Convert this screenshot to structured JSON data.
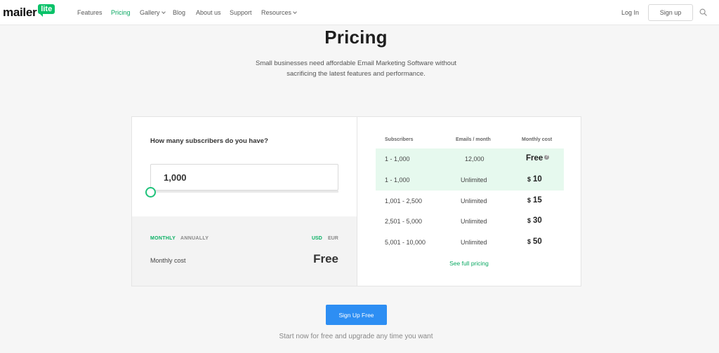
{
  "header": {
    "logo_text": "mailer",
    "logo_badge": "lite",
    "nav": [
      {
        "label": "Features"
      },
      {
        "label": "Pricing"
      },
      {
        "label": "Gallery"
      },
      {
        "label": "Blog"
      },
      {
        "label": "About us"
      },
      {
        "label": "Support"
      },
      {
        "label": "Resources"
      }
    ],
    "login_label": "Log In",
    "signup_label": "Sign up",
    "search_icon": "search-icon"
  },
  "hero": {
    "title": "Pricing",
    "subtitle": "Small businesses need affordable Email Marketing Software without sacrificing the latest features and performance."
  },
  "calculator": {
    "question": "How many subscribers do you have?",
    "subscribers_value": "1,000",
    "billing": {
      "monthly": "MONTHLY",
      "annually": "ANNUALLY"
    },
    "currency": {
      "usd": "USD",
      "eur": "EUR"
    },
    "cost_label": "Monthly cost",
    "cost_value": "Free"
  },
  "pricing_table": {
    "headers": {
      "subscribers": "Subscribers",
      "emails": "Emails / month",
      "cost": "Monthly cost"
    },
    "rows": [
      {
        "subscribers": "1 - 1,000",
        "emails": "12,000",
        "currency": "",
        "price": "Free",
        "help": "?"
      },
      {
        "subscribers": "1 - 1,000",
        "emails": "Unlimited",
        "currency": "$",
        "price": "10"
      },
      {
        "subscribers": "1,001 - 2,500",
        "emails": "Unlimited",
        "currency": "$",
        "price": "15"
      },
      {
        "subscribers": "2,501 - 5,000",
        "emails": "Unlimited",
        "currency": "$",
        "price": "30"
      },
      {
        "subscribers": "5,001 - 10,000",
        "emails": "Unlimited",
        "currency": "$",
        "price": "50"
      }
    ],
    "see_full": "See full pricing"
  },
  "cta": {
    "button": "Sign Up Free",
    "tagline": "Start now for free and upgrade any time you want"
  },
  "colors": {
    "accent_green": "#09b063",
    "highlight_row": "#e6f9ee",
    "cta_blue": "#2d8ef3"
  }
}
